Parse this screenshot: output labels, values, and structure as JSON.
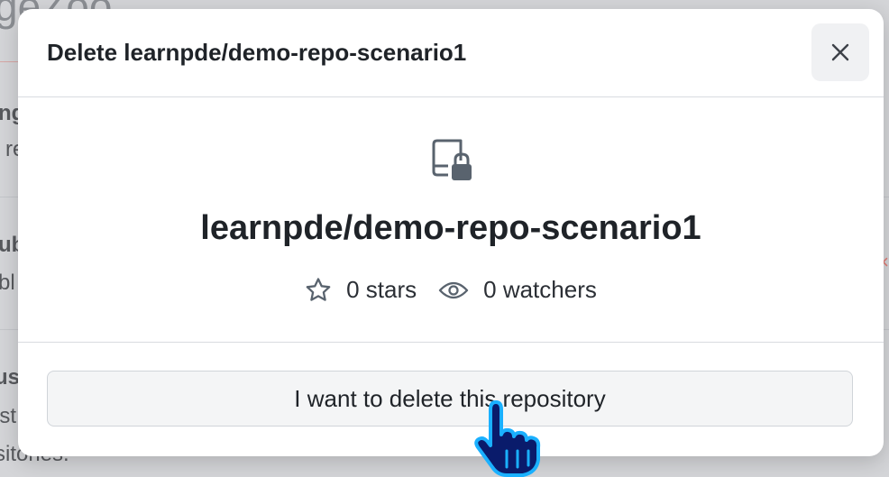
{
  "background": {
    "title_fragment": "geZoo",
    "fragments": [
      "ng",
      "re",
      "ub",
      "bl",
      "ust",
      "ist",
      "sitories."
    ],
    "close_x": "×"
  },
  "dialog": {
    "title": "Delete learnpde/demo-repo-scenario1",
    "close_icon": "close-icon",
    "repo_icon": "repo-locked-icon",
    "repo_name": "learnpde/demo-repo-scenario1",
    "stars": {
      "icon": "star-icon",
      "label": "0 stars"
    },
    "watchers": {
      "icon": "eye-icon",
      "label": "0 watchers"
    },
    "confirm_button": "I want to delete this repository"
  },
  "cursor": {
    "icon": "hand-pointer-icon",
    "color": "#1ab0ff"
  }
}
